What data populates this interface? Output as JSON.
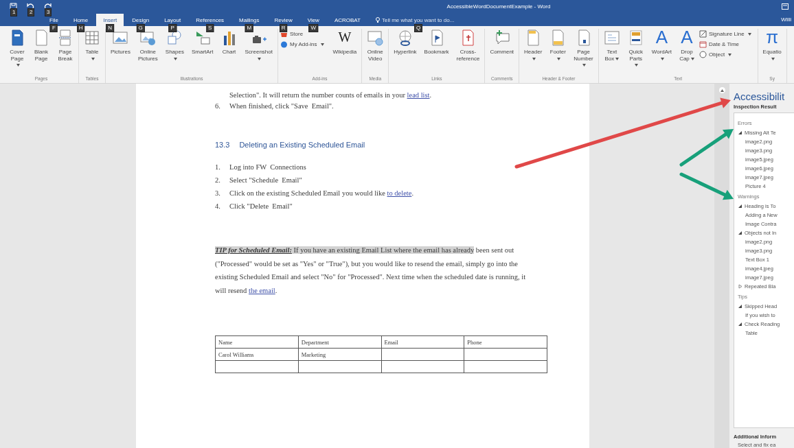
{
  "window": {
    "title": "AccessibleWordDocumentExample - Word",
    "account": "Willi"
  },
  "quick_access": [
    {
      "kind": "save",
      "keytip": "1"
    },
    {
      "kind": "undo",
      "keytip": "2"
    },
    {
      "kind": "redo",
      "keytip": "3"
    }
  ],
  "tabs": [
    {
      "label": "File",
      "keytip": "F",
      "selected": false
    },
    {
      "label": "Home",
      "keytip": "H",
      "selected": false
    },
    {
      "label": "Insert",
      "keytip": "N",
      "selected": true
    },
    {
      "label": "Design",
      "keytip": "G",
      "selected": false
    },
    {
      "label": "Layout",
      "keytip": "P",
      "selected": false
    },
    {
      "label": "References",
      "keytip": "S",
      "selected": false
    },
    {
      "label": "Mailings",
      "keytip": "M",
      "selected": false
    },
    {
      "label": "Review",
      "keytip": "R",
      "selected": false
    },
    {
      "label": "View",
      "keytip": "W",
      "selected": false
    },
    {
      "label": "ACROBAT",
      "selected": false
    }
  ],
  "tell_me": {
    "placeholder": "Tell me what you want to do...",
    "keytip": "Q"
  },
  "ribbon": [
    {
      "label": "Pages",
      "items": [
        {
          "kind": "cover",
          "label": "Cover Page",
          "dropdown": true
        },
        {
          "kind": "page",
          "label": "Blank Page",
          "dropdown": false
        },
        {
          "kind": "pagebreak",
          "label": "Page Break",
          "dropdown": false
        }
      ]
    },
    {
      "label": "Tables",
      "items": [
        {
          "kind": "table",
          "label": "Table",
          "dropdown": true
        }
      ]
    },
    {
      "label": "Illustrations",
      "items": [
        {
          "kind": "picture",
          "label": "Pictures",
          "dropdown": false
        },
        {
          "kind": "onlinepicture",
          "label": "Online Pictures",
          "dropdown": false
        },
        {
          "kind": "shapes",
          "label": "Shapes",
          "dropdown": true
        },
        {
          "kind": "smartart",
          "label": "SmartArt",
          "dropdown": false
        },
        {
          "kind": "chart",
          "label": "Chart",
          "dropdown": false
        },
        {
          "kind": "camera",
          "label": "Screenshot",
          "dropdown": true
        }
      ]
    },
    {
      "label": "Add-ins",
      "items": [
        {
          "kind": "stack",
          "items": [
            {
              "kind": "store",
              "label": "Store",
              "dropdown": false
            },
            {
              "kind": "addins",
              "label": "My Add-ins",
              "dropdown": true
            }
          ]
        },
        {
          "kind": "glyph",
          "glyph": "W",
          "label": "Wikipedia",
          "dropdown": false
        }
      ]
    },
    {
      "label": "Media",
      "items": [
        {
          "kind": "video",
          "label": "Online Video",
          "dropdown": false
        }
      ]
    },
    {
      "label": "Links",
      "items": [
        {
          "kind": "hyperlink",
          "label": "Hyperlink",
          "dropdown": false
        },
        {
          "kind": "bookmark",
          "label": "Bookmark",
          "dropdown": false
        },
        {
          "kind": "crossref",
          "label": "Cross-reference",
          "dropdown": false
        }
      ]
    },
    {
      "label": "Comments",
      "items": [
        {
          "kind": "comment",
          "label": "Comment",
          "dropdown": false
        }
      ]
    },
    {
      "label": "Header & Footer",
      "items": [
        {
          "kind": "header",
          "label": "Header",
          "dropdown": true
        },
        {
          "kind": "footer",
          "label": "Footer",
          "dropdown": true
        },
        {
          "kind": "pagenumber",
          "label": "Page Number",
          "dropdown": true
        }
      ]
    },
    {
      "label": "Text",
      "items": [
        {
          "kind": "textbox",
          "label": "Text Box",
          "dropdown": true
        },
        {
          "kind": "quickparts",
          "label": "Quick Parts",
          "dropdown": true
        },
        {
          "kind": "glyph",
          "glyph": "A",
          "label": "WordArt",
          "dropdown": true
        },
        {
          "kind": "glyph",
          "glyph": "A",
          "label": "Drop Cap",
          "dropdown": true
        },
        {
          "kind": "stack",
          "items": [
            {
              "kind": "signature",
              "label": "Signature Line",
              "dropdown": true
            },
            {
              "kind": "calendar",
              "label": "Date & Time",
              "dropdown": false
            },
            {
              "kind": "object",
              "label": "Object",
              "dropdown": true
            }
          ]
        }
      ]
    },
    {
      "label": "Sy",
      "items": [
        {
          "kind": "glyph",
          "glyph": "π",
          "label": "Equatio",
          "dropdown": true
        }
      ]
    }
  ],
  "document": {
    "paragraphs": [
      {
        "kind": "list",
        "parts": [
          {
            "kind": "plain",
            "text": "Selection\". It will return the number counts of emails in your "
          },
          {
            "kind": "link",
            "text": "lead  list"
          },
          {
            "kind": "plain",
            "text": "."
          }
        ]
      },
      {
        "kind": "list",
        "number": "6.",
        "parts": [
          {
            "kind": "plain",
            "text": "When finished, click \"Save  Email\"."
          }
        ]
      },
      {
        "kind": "heading",
        "number": "13.3",
        "parts": [
          {
            "kind": "plain",
            "text": "Deleting an Existing Scheduled Email"
          }
        ]
      },
      {
        "kind": "list",
        "number": "1.",
        "parts": [
          {
            "kind": "plain",
            "text": "Log into FW  Connections"
          }
        ]
      },
      {
        "kind": "list",
        "number": "2.",
        "parts": [
          {
            "kind": "plain",
            "text": "Select \"Schedule  Email\""
          }
        ]
      },
      {
        "kind": "list",
        "number": "3.",
        "parts": [
          {
            "kind": "plain",
            "text": "Click on the existing Scheduled Email you would like "
          },
          {
            "kind": "link",
            "text": "to  delete"
          },
          {
            "kind": "plain",
            "text": "."
          }
        ]
      },
      {
        "kind": "list",
        "number": "4.",
        "parts": [
          {
            "kind": "plain",
            "text": "Click \"Delete  Email\""
          }
        ]
      },
      {
        "kind": "body",
        "parts": [
          {
            "kind": "label",
            "text": "TIP for Scheduled Email:"
          },
          {
            "kind": "highlight",
            "text": " If you have an existing Email List where the email has already"
          },
          {
            "kind": "plain",
            "text": " been sent out (\"Processed\" would be set as \"Yes\" or \"True\"), but you would like to resend the email, simply go into the existing Scheduled Email and select \"No\" for \"Processed\". Next time when the scheduled date is running, it will resend "
          },
          {
            "kind": "link",
            "text": "the  email"
          },
          {
            "kind": "plain",
            "text": "."
          }
        ]
      }
    ],
    "table": {
      "columns": [
        "Name",
        "Department",
        "Email",
        "Phone"
      ],
      "rows": [
        {
          "kind": "data",
          "cells": [
            "Carol Williams",
            "Marketing"
          ]
        },
        {
          "kind": "blank"
        }
      ]
    }
  },
  "pane": {
    "title": "Accessibilit",
    "subtitle": "Inspection Result",
    "sections": [
      {
        "heading": "Errors",
        "items": [
          {
            "label": "Missing Alt Te",
            "expanded": true,
            "children": [
              {
                "label": "image2.png"
              },
              {
                "label": "image3.png"
              },
              {
                "label": "image5.jpeg"
              },
              {
                "label": "image6.jpeg"
              },
              {
                "label": "image7.jpeg"
              },
              {
                "label": "Picture 4"
              }
            ]
          }
        ]
      },
      {
        "heading": "Warnings",
        "items": [
          {
            "label": "Heading is To",
            "expanded": true,
            "children": [
              {
                "label": "Adding a New"
              },
              {
                "label": "Image Contra"
              }
            ]
          },
          {
            "label": "Objects not In",
            "expanded": true,
            "children": [
              {
                "label": "image2.png"
              },
              {
                "label": "image3.png"
              },
              {
                "label": "Text Box 1"
              },
              {
                "label": "image4.jpeg"
              },
              {
                "label": "image7.jpeg"
              }
            ]
          },
          {
            "label": "Repeated Bla",
            "expanded": false
          }
        ]
      },
      {
        "heading": "Tips",
        "items": [
          {
            "label": "Skipped Head",
            "expanded": true,
            "children": [
              {
                "label": "If you wish to"
              }
            ]
          },
          {
            "label": "Check Reading",
            "expanded": true,
            "children": [
              {
                "label": "Table"
              }
            ]
          }
        ]
      }
    ],
    "footer_title": "Additional Inform",
    "footer_text": "Select and fix ea"
  }
}
